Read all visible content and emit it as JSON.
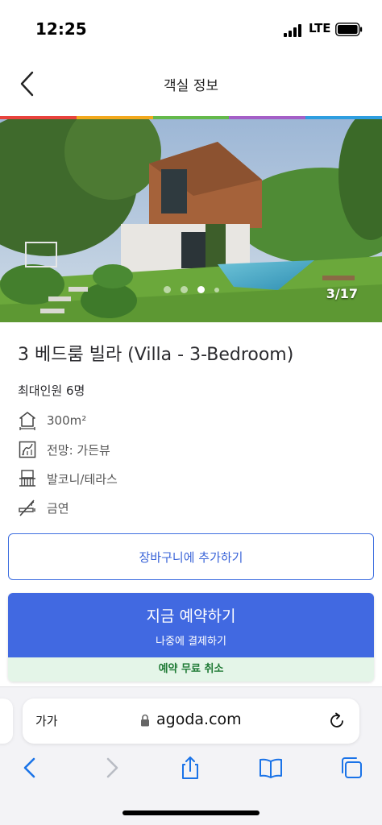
{
  "status_bar": {
    "time": "12:25",
    "network": "LTE"
  },
  "nav": {
    "title": "객실 정보"
  },
  "gallery": {
    "counter": "3/17"
  },
  "room": {
    "title": "3 베드룸 빌라 (Villa - 3-Bedroom)",
    "max_occupancy": "최대인원 6명",
    "amenities": [
      {
        "icon": "room-size-icon",
        "label": "300m²"
      },
      {
        "icon": "view-icon",
        "label": "전망: 가든뷰"
      },
      {
        "icon": "balcony-icon",
        "label": "발코니/테라스"
      },
      {
        "icon": "no-smoking-icon",
        "label": "금연"
      }
    ]
  },
  "actions": {
    "add_to_cart": "장바구니에 추가하기",
    "book_now": "지금 예약하기",
    "pay_later": "나중에 결제하기",
    "free_cancellation": "예약 무료 취소"
  },
  "browser": {
    "text_size_label": "가가",
    "url": "agoda.com",
    "toolbar": [
      "back-icon",
      "forward-icon",
      "share-icon",
      "bookmarks-icon",
      "tabs-icon"
    ]
  },
  "colors": {
    "primary": "#4169e1",
    "free_cancel_bg": "#e4f5e8",
    "free_cancel_text": "#1f7a35",
    "rainbow": [
      "#e8433d",
      "#f2a91d",
      "#64b94b",
      "#a45fc7",
      "#2e9ee0"
    ]
  }
}
